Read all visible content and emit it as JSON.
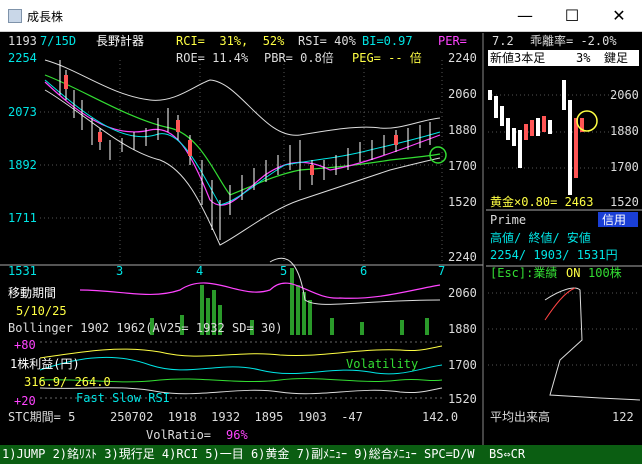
{
  "window": {
    "title": "成長株",
    "buttons": {
      "minimize": "—",
      "maximize": "☐",
      "close": "✕"
    }
  },
  "header": {
    "code": "1193",
    "date": "7/15D",
    "company": "長野計器",
    "rci": "RCI=  31%,  52%",
    "rsi": "RSI= 40%",
    "bi": "BI=0.97",
    "per": "PER=",
    "roe": "ROE= 11.4%",
    "pbr": "PBR= 0.8倍",
    "peg": "PEG= -- 倍"
  },
  "main_chart": {
    "y_labels_left": [
      "2254",
      "2073",
      "1892",
      "1711",
      "1531"
    ],
    "y_labels_right": [
      "2240",
      "2060",
      "1880",
      "1700",
      "1520",
      "2240"
    ],
    "x_labels": [
      "3",
      "4",
      "5",
      "6",
      "7"
    ]
  },
  "right_top": {
    "value": "7.2",
    "deviation": "乖離率= -2.0%",
    "new_high": "新値3本足",
    "pct": "3%",
    "kind": "鍵足",
    "y_labels": [
      "2060",
      "1880",
      "1700",
      "1520"
    ],
    "golden": "黄金×0.80= 2463"
  },
  "price_box": {
    "market": "Prime",
    "credit": "信用",
    "header": "高値/ 終値/ 安値",
    "values": "2254/ 1903/ 1531円",
    "esc": "[Esc]:業績",
    "on": "ON",
    "unit": "100株"
  },
  "indicators": {
    "moving_avg_label": "移動期間",
    "moving_avg_value": "5/10/25",
    "bollinger": "Bollinger 1902 1962(AV25= 1932 SD= 30)",
    "plus80": "+80",
    "eps_label": "1株利益(円)",
    "eps_value": "316.9/ 264.0",
    "volatility": "Volatility",
    "stoch_label": "Fast Slow RSI",
    "plus20": "+20",
    "stc_label": "STC期間= 5",
    "stc_values": "250702  1918  1932  1895  1903  -47",
    "stc_right": "142.0",
    "vol_ratio_label": "VolRatio=",
    "vol_ratio": "96%",
    "lower_right_labels": [
      "2060",
      "1880",
      "1700",
      "1520"
    ]
  },
  "volume_box": {
    "label": "平均出来高",
    "value": "122"
  },
  "menu": "1)JUMP 2)銘ﾘｽﾄ 3)現行足 4)RCI 5)一目 6)黄金 7)副ﾒﾆｭｰ 9)総合ﾒﾆｭｰ SPC=D/W  BS⇔CR",
  "colors": {
    "bg": "#000000",
    "gold_text": "#ffff44",
    "cyan_text": "#00e5e5",
    "magenta": "#ff44ff",
    "green_line": "#33dd33",
    "status_bar": "#0b5e12"
  }
}
